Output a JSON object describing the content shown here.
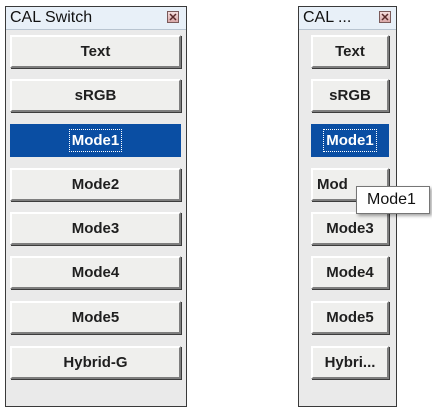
{
  "left_window": {
    "title": "CAL Switch",
    "buttons": [
      "Text",
      "sRGB",
      "Mode1",
      "Mode2",
      "Mode3",
      "Mode4",
      "Mode5",
      "Hybrid-G"
    ],
    "selected": "Mode1"
  },
  "right_window": {
    "title": "CAL ...",
    "buttons": [
      "Text",
      "sRGB",
      "Mode1",
      "Mod",
      "Mode3",
      "Mode4",
      "Mode5",
      "Hybri..."
    ],
    "selected": "Mode1"
  },
  "tooltip": {
    "text": "Mode1"
  },
  "colors": {
    "selected": "#0a4ea3",
    "titlebar": "#e8f0f8",
    "close_button": "#d9a8a8"
  }
}
